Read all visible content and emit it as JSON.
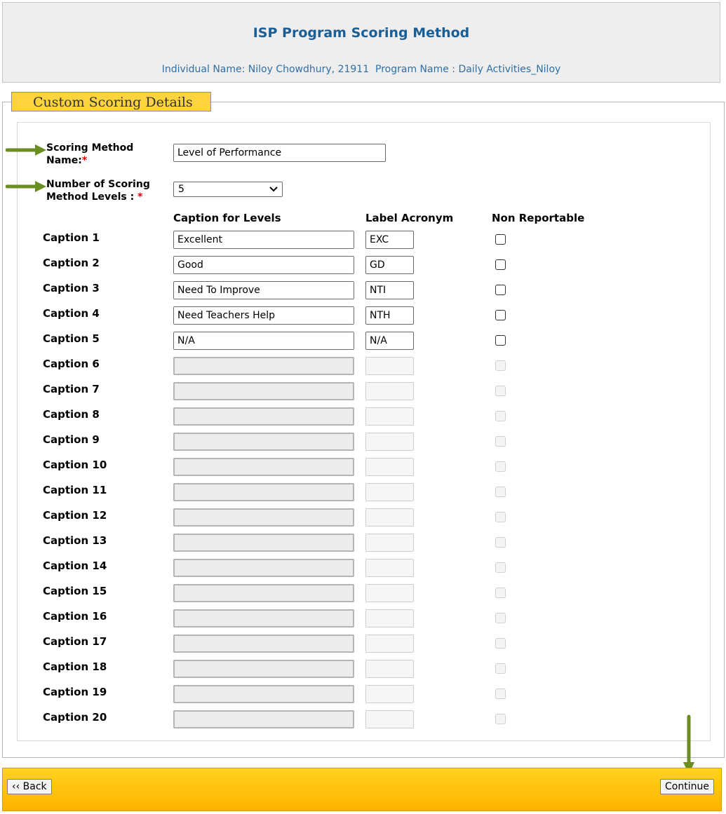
{
  "header": {
    "title": "ISP Program Scoring Method",
    "subtitle": "Individual Name: Niloy Chowdhury, 21911  Program Name : Daily Activities_Niloy"
  },
  "section": {
    "legend": "Custom Scoring Details"
  },
  "form": {
    "name_label_line1": "Scoring Method",
    "name_label_line2": "Name:",
    "name_value": "Level of Performance",
    "levels_label_line1": "Number of Scoring",
    "levels_label_line2": "Method Levels : ",
    "levels_value": "5",
    "required_mark": "*"
  },
  "columns": {
    "caption": "Caption for Levels",
    "acronym": "Label Acronym",
    "non_reportable": "Non Reportable"
  },
  "captions": [
    {
      "label": "Caption 1",
      "value": "Excellent",
      "acronym": "EXC"
    },
    {
      "label": "Caption 2",
      "value": "Good",
      "acronym": "GD"
    },
    {
      "label": "Caption 3",
      "value": "Need To Improve",
      "acronym": "NTI"
    },
    {
      "label": "Caption 4",
      "value": "Need Teachers Help",
      "acronym": "NTH"
    },
    {
      "label": "Caption 5",
      "value": "N/A",
      "acronym": "N/A"
    },
    {
      "label": "Caption 6",
      "value": "",
      "acronym": ""
    },
    {
      "label": "Caption 7",
      "value": "",
      "acronym": ""
    },
    {
      "label": "Caption 8",
      "value": "",
      "acronym": ""
    },
    {
      "label": "Caption 9",
      "value": "",
      "acronym": ""
    },
    {
      "label": "Caption 10",
      "value": "",
      "acronym": ""
    },
    {
      "label": "Caption 11",
      "value": "",
      "acronym": ""
    },
    {
      "label": "Caption 12",
      "value": "",
      "acronym": ""
    },
    {
      "label": "Caption 13",
      "value": "",
      "acronym": ""
    },
    {
      "label": "Caption 14",
      "value": "",
      "acronym": ""
    },
    {
      "label": "Caption 15",
      "value": "",
      "acronym": ""
    },
    {
      "label": "Caption 16",
      "value": "",
      "acronym": ""
    },
    {
      "label": "Caption 17",
      "value": "",
      "acronym": ""
    },
    {
      "label": "Caption 18",
      "value": "",
      "acronym": ""
    },
    {
      "label": "Caption 19",
      "value": "",
      "acronym": ""
    },
    {
      "label": "Caption 20",
      "value": "",
      "acronym": ""
    }
  ],
  "footer": {
    "back_label": "‹‹ Back",
    "continue_label": "Continue"
  },
  "colors": {
    "title": "#1a5e96",
    "legend_bg": "#fdd33e",
    "footer": "#ffc107",
    "arrow": "#6b8e23",
    "required": "#e00000"
  },
  "icons": [
    "chevron-down-icon",
    "annotation-arrow-icon"
  ]
}
